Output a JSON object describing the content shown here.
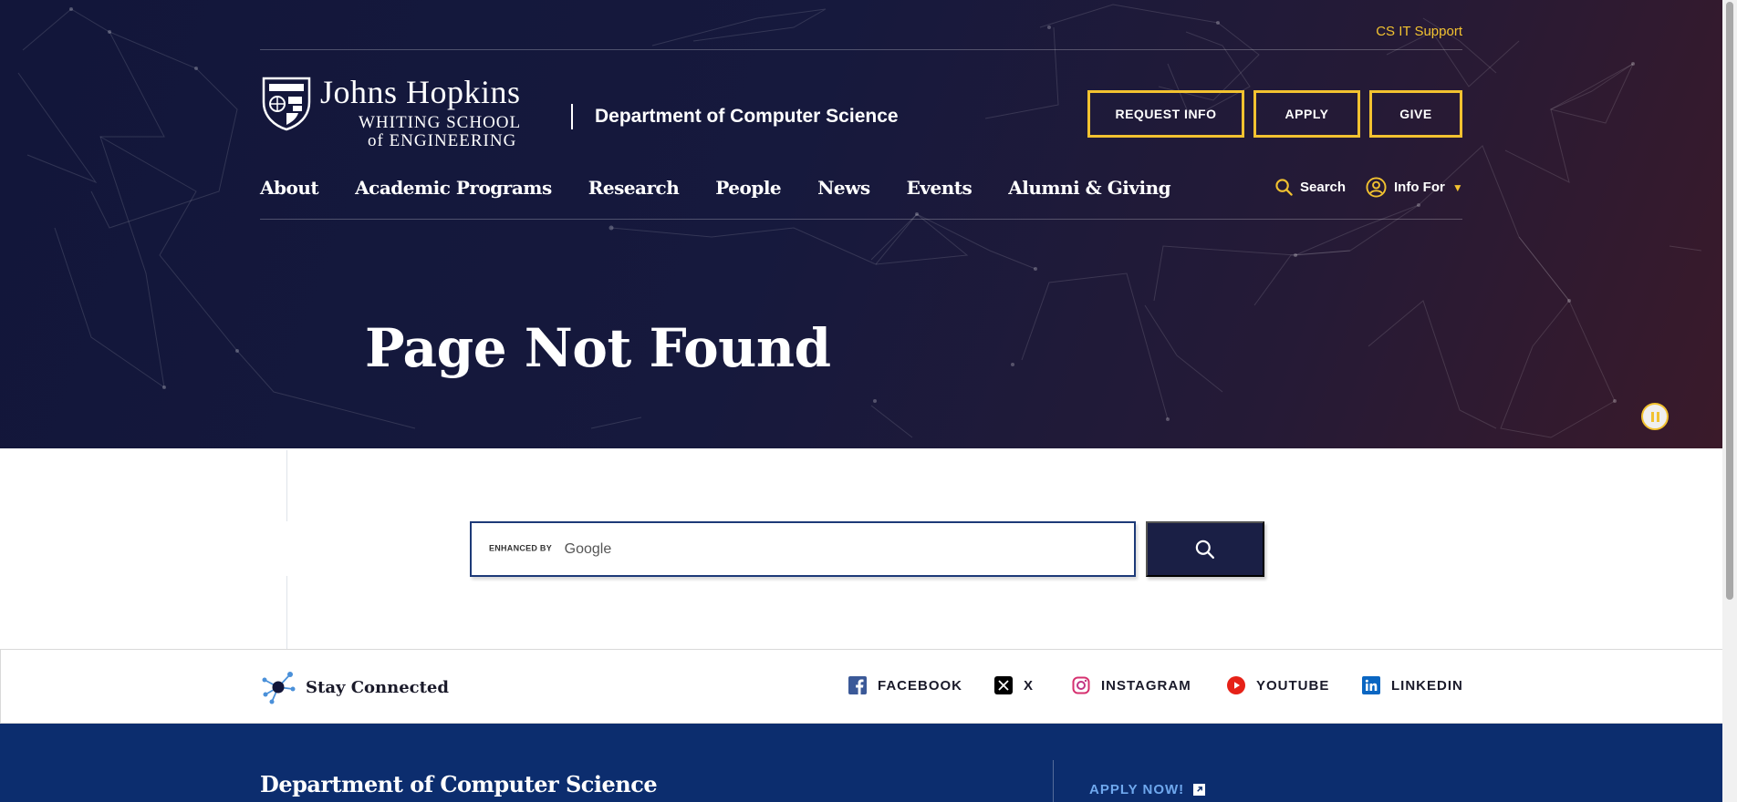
{
  "header": {
    "utility_link": "CS IT Support",
    "logo": {
      "line1": "Johns Hopkins",
      "line2": "WHITING SCHOOL",
      "line3": "of ENGINEERING"
    },
    "department": "Department of Computer Science",
    "cta_buttons": {
      "request_info": "REQUEST INFO",
      "apply": "APPLY",
      "give": "GIVE"
    },
    "nav": [
      {
        "label": "About"
      },
      {
        "label": "Academic Programs"
      },
      {
        "label": "Research"
      },
      {
        "label": "People"
      },
      {
        "label": "News"
      },
      {
        "label": "Events"
      },
      {
        "label": "Alumni & Giving"
      }
    ],
    "search_label": "Search",
    "info_for_label": "Info For"
  },
  "hero": {
    "title": "Page Not Found"
  },
  "search": {
    "enhanced_by": "ENHANCED BY",
    "google": "Google"
  },
  "social": {
    "heading": "Stay Connected",
    "links": [
      {
        "label": "FACEBOOK",
        "icon": "facebook-icon"
      },
      {
        "label": "X",
        "icon": "x-icon"
      },
      {
        "label": "INSTAGRAM",
        "icon": "instagram-icon"
      },
      {
        "label": "YOUTUBE",
        "icon": "youtube-icon"
      },
      {
        "label": "LINKEDIN",
        "icon": "linkedin-icon"
      }
    ]
  },
  "footer": {
    "title": "Department of Computer Science",
    "apply_now": "APPLY NOW!"
  },
  "colors": {
    "hero_bg": "#14183c",
    "accent_gold": "#f2c230",
    "footer_bg": "#0c2d6e",
    "search_button": "#1a1f45"
  }
}
